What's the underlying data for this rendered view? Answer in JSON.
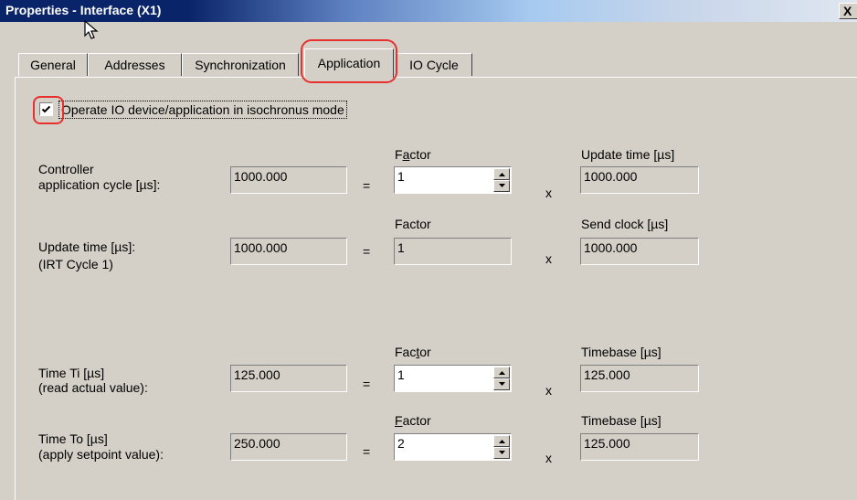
{
  "window": {
    "title": "Properties - Interface (X1)",
    "close_label": "X"
  },
  "tabs": [
    {
      "label": "General",
      "active": false
    },
    {
      "label": "Addresses",
      "active": false
    },
    {
      "label": "Synchronization",
      "active": false
    },
    {
      "label": "Application",
      "active": true
    },
    {
      "label": "IO Cycle",
      "active": false
    }
  ],
  "isochronous": {
    "checked": true,
    "label": "Operate IO device/application in isochronus mode"
  },
  "rows": [
    {
      "label_line1": "Controller",
      "label_line2": "application cycle [µs]:",
      "value": "1000.000",
      "equals": "=",
      "factor_header": "Factor",
      "factor_value": "1",
      "factor_editable": true,
      "times": "x",
      "result_header": "Update time [µs]",
      "result_value": "1000.000"
    },
    {
      "label_line1": "Update time [µs]:",
      "label_line2": " (IRT Cycle 1)",
      "value": "1000.000",
      "equals": "=",
      "factor_header": "Factor",
      "factor_value": "1",
      "factor_editable": false,
      "times": "x",
      "result_header": "Send clock [µs]",
      "result_value": "1000.000"
    },
    {
      "label_line1": "Time Ti  [µs]",
      "label_line2": "(read actual value):",
      "value": "125.000",
      "equals": "=",
      "factor_header": "Factor",
      "factor_value": "1",
      "factor_editable": true,
      "times": "x",
      "result_header": "Timebase [µs]",
      "result_value": "125.000"
    },
    {
      "label_line1": "Time To  [µs]",
      "label_line2": "(apply setpoint value):",
      "value": "250.000",
      "equals": "=",
      "factor_header": "Factor",
      "factor_value": "2",
      "factor_editable": true,
      "times": "x",
      "result_header": "Timebase [µs]",
      "result_value": "125.000"
    }
  ],
  "colors": {
    "titlebar_start": "#0a246a",
    "titlebar_end": "#dfe6f0",
    "dialog_face": "#d4d0c8",
    "highlight_annotation": "#e8312f"
  },
  "icons": {
    "cursor": "arrow-cursor-icon",
    "checkbox": "checkmark-icon",
    "spinner_up": "triangle-up-icon",
    "spinner_down": "triangle-down-icon"
  }
}
